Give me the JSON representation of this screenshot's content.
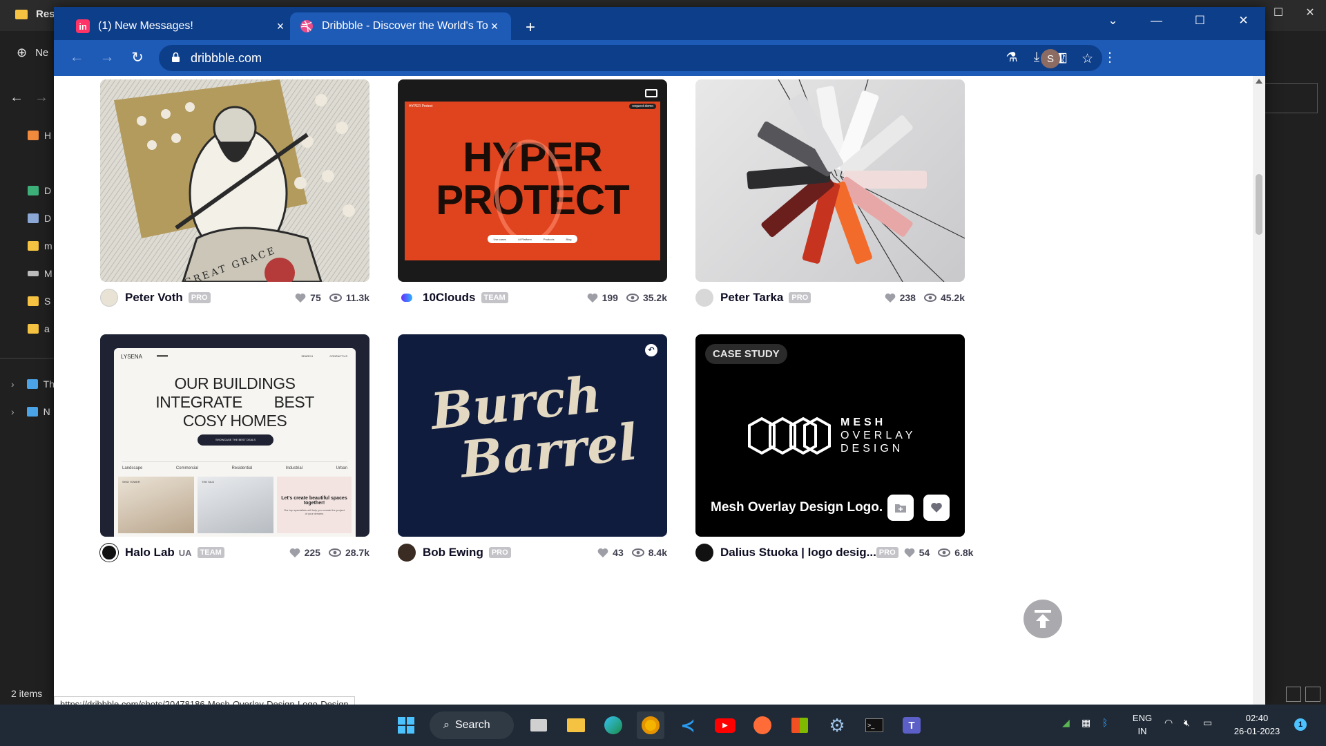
{
  "explorer": {
    "title": "Res",
    "new_label": "Ne",
    "sidebar_labels": [
      "H",
      "D",
      "D",
      "m",
      "M",
      "S",
      "a"
    ],
    "tree_labels": [
      "Th",
      "N"
    ],
    "status": "2 items"
  },
  "browser": {
    "tabs": [
      {
        "title": "(1) New Messages!",
        "favicon": "in",
        "favicon_color": "#ff3366",
        "active": false
      },
      {
        "title": "Dribbble - Discover the World's Top Designers & Creative Professionals",
        "favicon": "dribbble-icon",
        "favicon_color": "#ea4c89",
        "active": true
      }
    ],
    "url": "dribbble.com",
    "profile_initial": "S",
    "status_url": "https://dribbble.com/shots/20478186-Mesh-Overlay-Design-Logo-Design"
  },
  "shots": [
    {
      "author": "Peter Voth",
      "sub": "",
      "badge": "PRO",
      "likes": "75",
      "views": "11.3k",
      "art_text": "GREAT GRACE"
    },
    {
      "author": "10Clouds",
      "sub": "",
      "badge": "TEAM",
      "likes": "199",
      "views": "35.2k",
      "art_title_1": "HYPER",
      "art_title_2": "PROTECT",
      "art_brand": "HYPER Protect",
      "art_button": "request demo",
      "art_nav": [
        "Use cases",
        "AI Platform",
        "Products",
        "Blog"
      ]
    },
    {
      "author": "Peter Tarka",
      "sub": "",
      "badge": "PRO",
      "likes": "238",
      "views": "45.2k"
    },
    {
      "author": "Halo Lab",
      "sub": "UA",
      "badge": "TEAM",
      "likes": "225",
      "views": "28.7k",
      "art_logo": "LYSENA",
      "art_nav": [
        "SEARCH",
        "CONTACT US"
      ],
      "art_headline": [
        "OUR BUILDINGS",
        "INTEGRATE",
        "BEST",
        "COSY HOMES"
      ],
      "art_cta": "SHOWCASE THE BEST DEALS",
      "art_filters": [
        "Landscape",
        "Commercial",
        "Residential",
        "Industrial",
        "Urban"
      ],
      "art_cards": [
        "SHIO TOWER",
        "THE SILO"
      ],
      "art_promo": "Let's create beautiful spaces together!",
      "art_promo_sub": "Our top specialists will help you create the project of your dreams"
    },
    {
      "author": "Bob Ewing",
      "sub": "",
      "badge": "PRO",
      "likes": "43",
      "views": "8.4k",
      "art_line_1": "Burch",
      "art_line_2": "Barrel"
    },
    {
      "author": "Dalius Stuoka | logo desig...",
      "sub": "",
      "badge": "PRO",
      "likes": "54",
      "views": "6.8k",
      "tag": "CASE STUDY",
      "overlay_title": "Mesh Overlay Design Logo...",
      "art_text": [
        "MESH",
        "OVERLAY",
        "DESIGN"
      ]
    }
  ],
  "taskbar": {
    "search_label": "Search",
    "lang_1": "ENG",
    "lang_2": "IN",
    "time": "02:40",
    "date": "26-01-2023",
    "notification_count": "1"
  }
}
